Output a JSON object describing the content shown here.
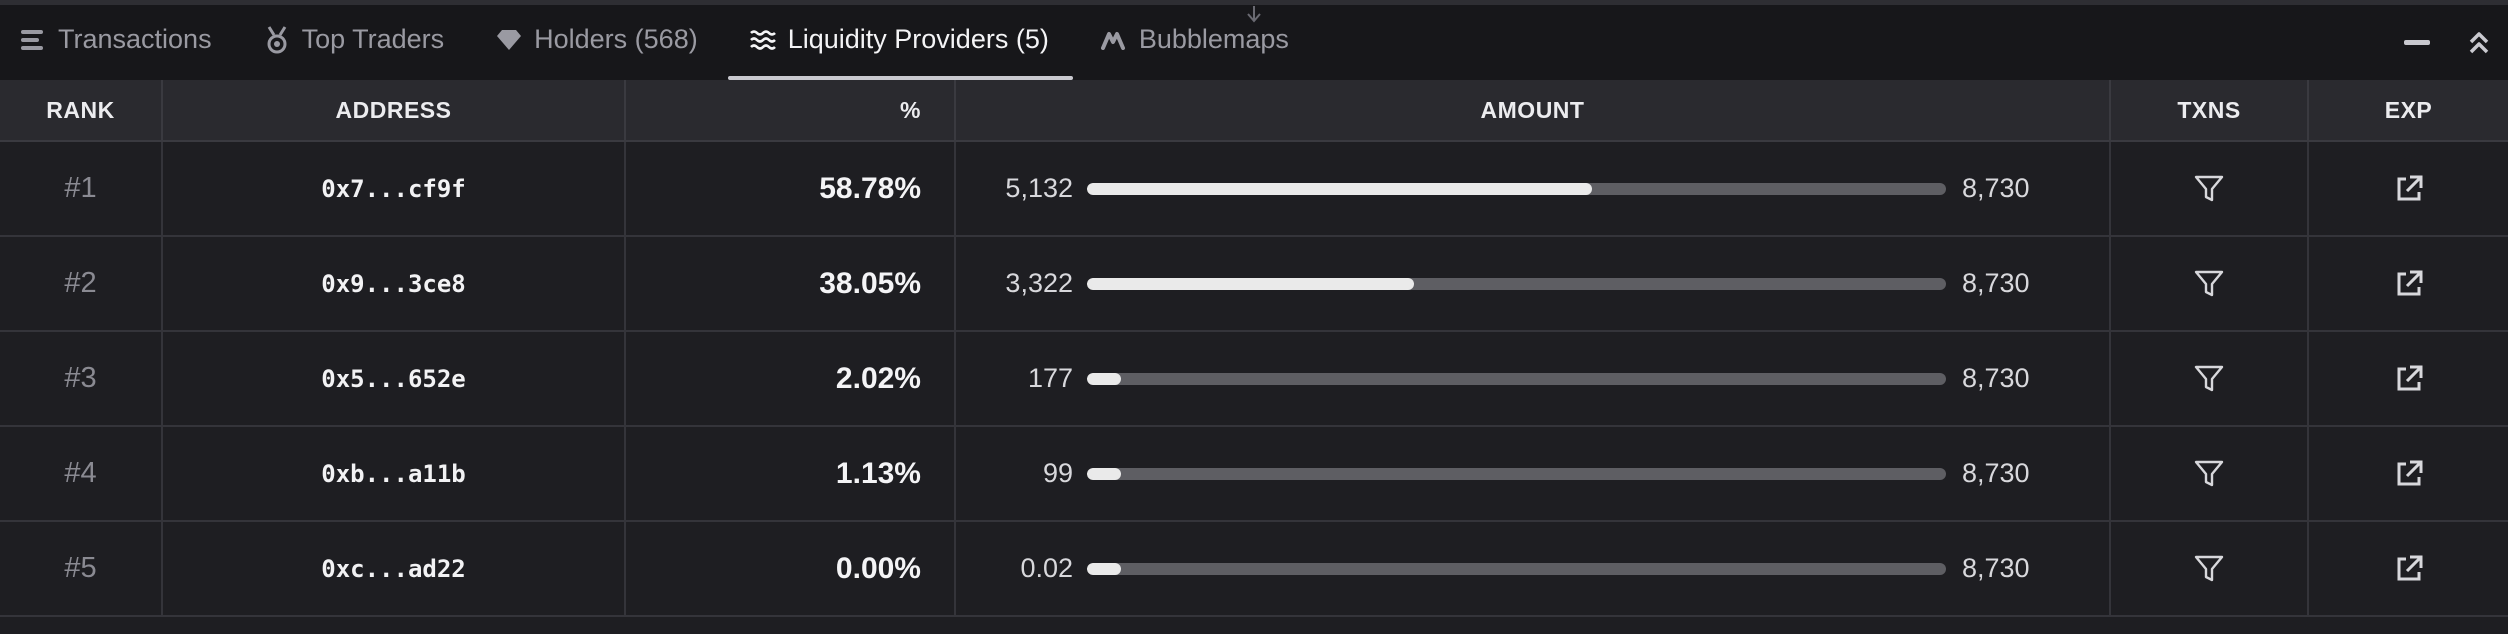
{
  "tabs": [
    {
      "label": "Transactions",
      "icon": "list-icon",
      "active": false
    },
    {
      "label": "Top Traders",
      "icon": "medal-icon",
      "active": false
    },
    {
      "label": "Holders (568)",
      "icon": "diamond-icon",
      "active": false
    },
    {
      "label": "Liquidity Providers (5)",
      "icon": "waves-icon",
      "active": true
    },
    {
      "label": "Bubblemaps",
      "icon": "bubblemaps-icon",
      "active": false
    }
  ],
  "window_controls": [
    "minimize-icon",
    "collapse-up-icon"
  ],
  "columns": {
    "rank": "RANK",
    "address": "ADDRESS",
    "percent": "%",
    "amount": "AMOUNT",
    "txns": "TXNS",
    "exp": "EXP"
  },
  "rows": [
    {
      "rank": "#1",
      "address": "0x7...cf9f",
      "percent": "58.78%",
      "amount": "5,132",
      "total": "8,730",
      "fill": 0.5878
    },
    {
      "rank": "#2",
      "address": "0x9...3ce8",
      "percent": "38.05%",
      "amount": "3,322",
      "total": "8,730",
      "fill": 0.3805
    },
    {
      "rank": "#3",
      "address": "0x5...652e",
      "percent": "2.02%",
      "amount": "177",
      "total": "8,730",
      "fill": 0.0202
    },
    {
      "rank": "#4",
      "address": "0xb...a11b",
      "percent": "1.13%",
      "amount": "99",
      "total": "8,730",
      "fill": 0.0113
    },
    {
      "rank": "#5",
      "address": "0xc...ad22",
      "percent": "0.00%",
      "amount": "0.02",
      "total": "8,730",
      "fill": 0.0
    }
  ],
  "colors": {
    "background": "#1e1e22",
    "header": "#2a2a2f",
    "bar_fill": "#eaeaea",
    "bar_track": "#5e5e63"
  }
}
